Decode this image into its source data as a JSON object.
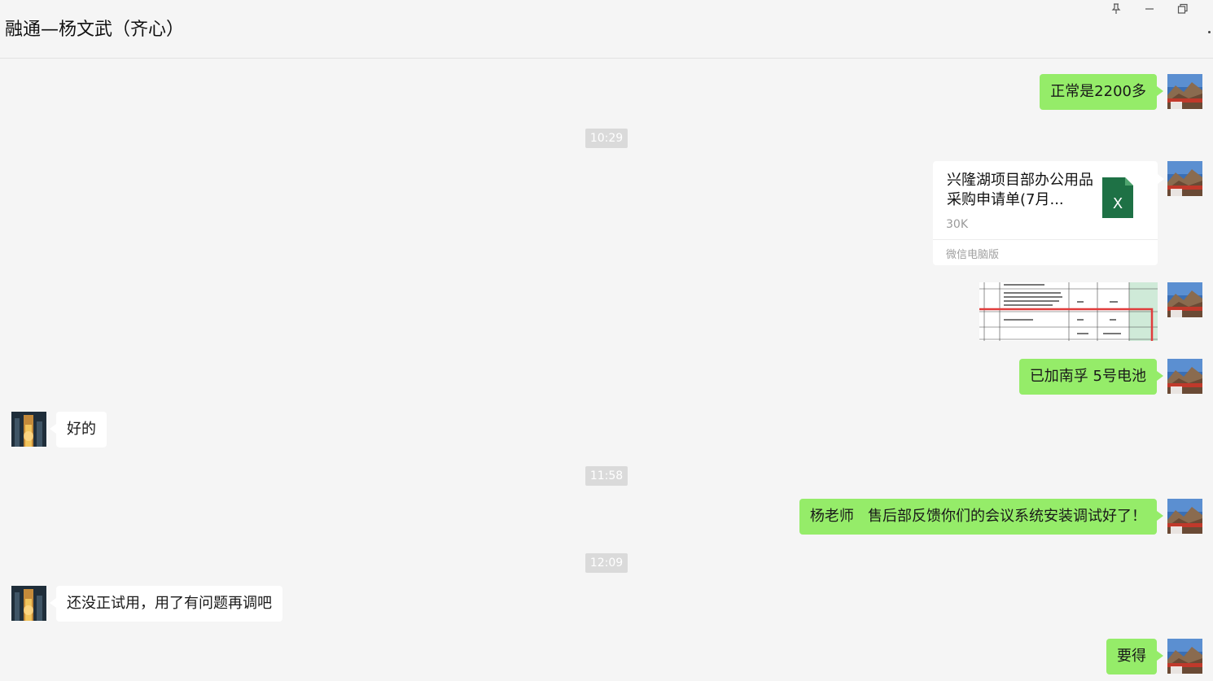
{
  "window": {
    "title": "融通—杨文武（齐心）",
    "controls": [
      "pin-icon",
      "minimize-icon",
      "restore-icon"
    ]
  },
  "messages": [
    {
      "type": "text",
      "side": "right",
      "text": "正常是2200多"
    },
    {
      "type": "timestamp",
      "text": "10:29"
    },
    {
      "type": "file",
      "side": "right",
      "file_name": "兴隆湖项目部办公用品采购申请单(7月...",
      "file_size": "30K",
      "source": "微信电脑版",
      "icon": "excel-icon"
    },
    {
      "type": "image",
      "side": "right",
      "description": "spreadsheet-screenshot"
    },
    {
      "type": "text",
      "side": "right",
      "text": "已加南孚 5号电池"
    },
    {
      "type": "text",
      "side": "left",
      "text": "好的"
    },
    {
      "type": "timestamp",
      "text": "11:58"
    },
    {
      "type": "text",
      "side": "right",
      "text": "杨老师   售后部反馈你们的会议系统安装调试好了！"
    },
    {
      "type": "timestamp",
      "text": "12:09"
    },
    {
      "type": "text",
      "side": "left",
      "text": "还没正试用，用了有问题再调吧"
    },
    {
      "type": "text",
      "side": "right",
      "text": "要得"
    }
  ],
  "colors": {
    "background": "#f5f5f5",
    "sent_bubble": "#95ec69",
    "received_bubble": "#ffffff",
    "timestamp_bg": "#dadada",
    "excel_green": "#1e7145"
  }
}
